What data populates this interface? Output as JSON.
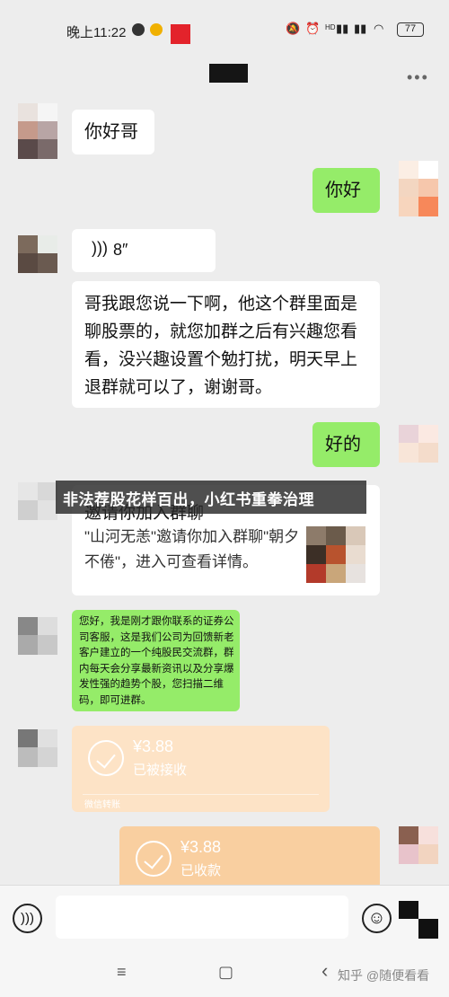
{
  "status_bar": {
    "time": "晚上11:22",
    "right_icons": [
      "mute-icon",
      "alarm-icon",
      "signal-icon",
      "signal-icon",
      "wifi-icon"
    ],
    "hd_label": "HD",
    "battery": "77"
  },
  "header": {
    "more": "•••"
  },
  "messages": {
    "m1": "你好哥",
    "m2": "你好",
    "voice_duration": "8″",
    "m4": "哥我跟您说一下啊，他这个群里面是聊股票的，就您加群之后有兴趣您看看，没兴趣设置个勉打扰，明天早上退群就可以了，谢谢哥。",
    "m5": "好的",
    "invite": {
      "title": "邀请你加入群聊",
      "text": "\"山河无恙\"邀请你加入群聊\"朝夕不倦\"，进入可查看详情。"
    },
    "m7": "您好，我是刚才跟你联系的证券公司客服，这是我们公司为回馈新老客户建立的一个纯股民交流群，群内每天会分享最新资讯以及分享爆发性强的趋势个股，您扫描二维码，即可进群。",
    "transfer1": {
      "amount": "¥3.88",
      "status": "已被接收",
      "footer": "微信转账"
    },
    "transfer2": {
      "amount": "¥3.88",
      "status": "已收款"
    }
  },
  "overlay_caption": "非法荐股花样百出，小红书重拳治理",
  "input": {
    "placeholder": ""
  },
  "nav": {
    "menu": "≡",
    "home": "▢",
    "back": "‹"
  },
  "watermark": "知乎 @随便看看",
  "colors": {
    "bubble_green": "#95ec69",
    "transfer_orange": "#f9cfa0",
    "background": "#ededed"
  }
}
